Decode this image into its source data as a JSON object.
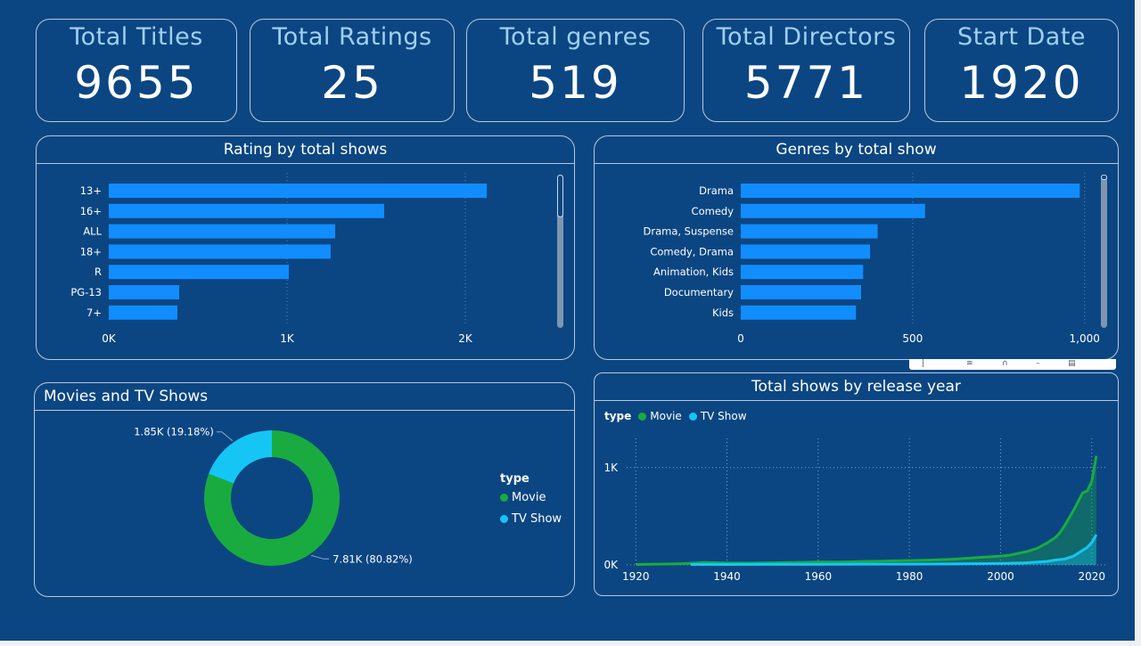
{
  "kpis": [
    {
      "label": "Total Titles",
      "value": "9655"
    },
    {
      "label": "Total Ratings",
      "value": "25"
    },
    {
      "label": "Total genres",
      "value": "519"
    },
    {
      "label": "Total Directors",
      "value": "5771"
    },
    {
      "label": "Start Date",
      "value": "1920"
    }
  ],
  "panels": {
    "rating_title": "Rating by total shows",
    "genres_title": "Genres by total show",
    "donut_title": "Movies and TV Shows",
    "line_title": "Total shows by release year"
  },
  "colors": {
    "background": "#0b4682",
    "bar": "#118dff",
    "movie": "#1aab40",
    "tv_show": "#15c6f4",
    "kpi_label": "#9fd0f2"
  },
  "toolbar_icons": [
    "pin-icon",
    "analytics-icon",
    "filter-icon",
    "more-options-icon",
    "focus-mode-icon"
  ],
  "chart_data": [
    {
      "type": "bar",
      "orientation": "horizontal",
      "title": "Rating by total shows",
      "categories": [
        "13+",
        "16+",
        "ALL",
        "18+",
        "R",
        "PG-13",
        "7+"
      ],
      "values": [
        2120,
        1545,
        1270,
        1245,
        1010,
        395,
        385
      ],
      "xlim": [
        0,
        2500
      ],
      "xticks": [
        "0K",
        "1K",
        "2K"
      ],
      "grid": true
    },
    {
      "type": "bar",
      "orientation": "horizontal",
      "title": "Genres by total show",
      "categories": [
        "Drama",
        "Comedy",
        "Drama, Suspense",
        "Comedy, Drama",
        "Animation, Kids",
        "Documentary",
        "Kids"
      ],
      "values": [
        986,
        536,
        398,
        376,
        356,
        350,
        335
      ],
      "xlim": [
        0,
        1050
      ],
      "xticks": [
        "0",
        "500",
        "1,000"
      ],
      "grid": true
    },
    {
      "type": "pie",
      "variant": "donut",
      "title": "Movies and TV Shows",
      "legend_title": "type",
      "labels": [
        "Movie",
        "TV Show"
      ],
      "values": [
        7810,
        1850
      ],
      "data_labels": [
        "7.81K (80.82%)",
        "1.85K (19.18%)"
      ],
      "legend_position": "right"
    },
    {
      "type": "area",
      "title": "Total shows by release year",
      "legend_title": "type",
      "legend_position": "top-left",
      "x_ticks": [
        "1920",
        "1940",
        "1960",
        "1980",
        "2000",
        "2020"
      ],
      "y_ticks": [
        "0K",
        "1K"
      ],
      "ylim": [
        0,
        1300
      ],
      "xlim": [
        1918,
        2022
      ],
      "grid": true,
      "series": [
        {
          "name": "Movie",
          "x": [
            1920,
            1925,
            1930,
            1935,
            1940,
            1945,
            1950,
            1955,
            1960,
            1965,
            1970,
            1975,
            1980,
            1985,
            1990,
            1995,
            2000,
            2002,
            2004,
            2006,
            2008,
            2010,
            2011,
            2012,
            2013,
            2014,
            2015,
            2016,
            2017,
            2018,
            2019,
            2020,
            2021
          ],
          "values": [
            5,
            8,
            12,
            25,
            20,
            18,
            22,
            25,
            30,
            30,
            35,
            40,
            45,
            50,
            60,
            75,
            90,
            100,
            120,
            140,
            170,
            220,
            250,
            280,
            330,
            400,
            480,
            560,
            650,
            740,
            760,
            860,
            1120
          ]
        },
        {
          "name": "TV Show",
          "x": [
            1932,
            1940,
            1950,
            1960,
            1970,
            1980,
            1990,
            2000,
            2005,
            2010,
            2012,
            2014,
            2016,
            2017,
            2018,
            2019,
            2020,
            2021
          ],
          "values": [
            5,
            5,
            6,
            6,
            8,
            8,
            10,
            15,
            20,
            35,
            50,
            60,
            90,
            120,
            150,
            180,
            230,
            310
          ]
        }
      ]
    }
  ]
}
